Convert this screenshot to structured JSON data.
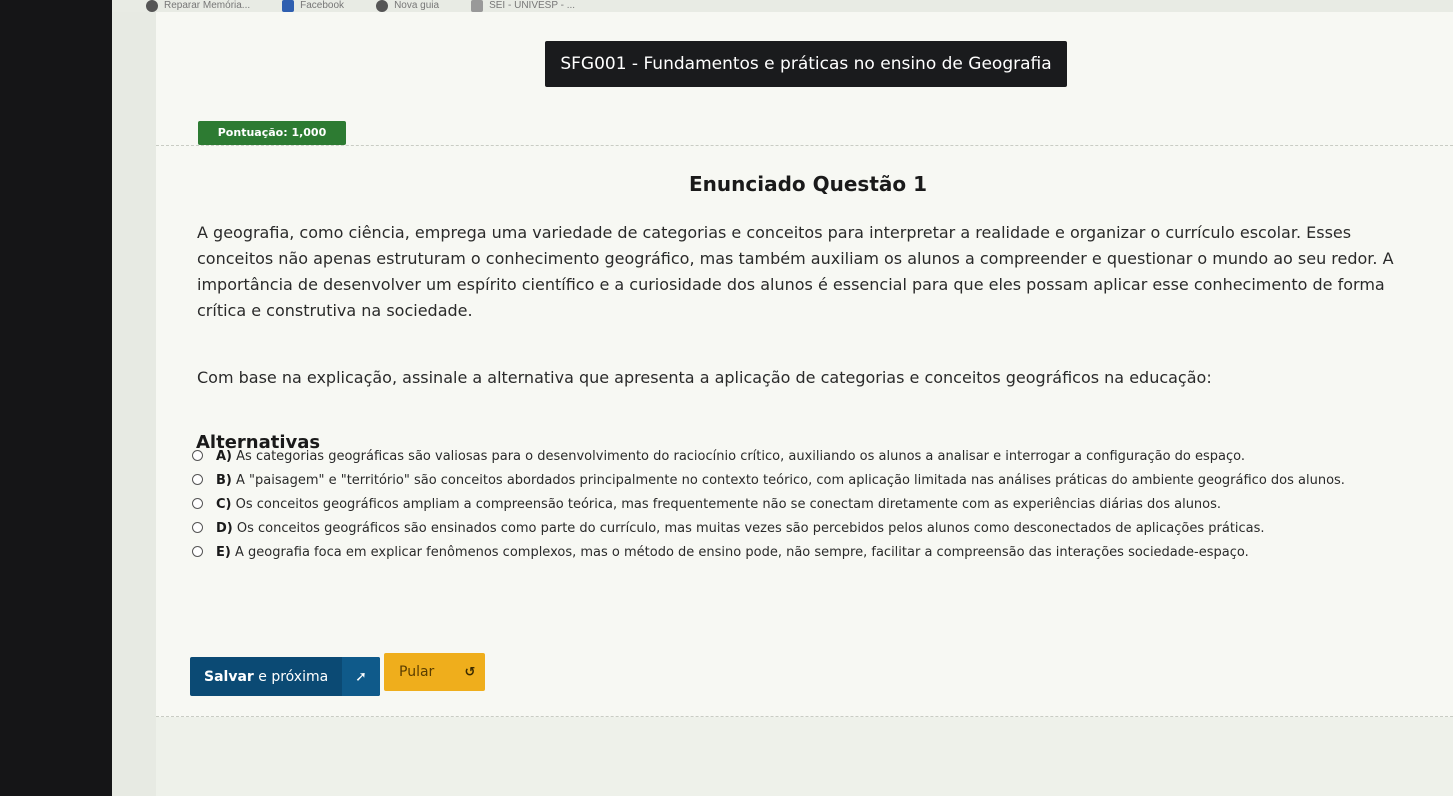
{
  "browser": {
    "bookmarks": [
      {
        "label": "Reparar Memória...",
        "icon": "bookmark-icon"
      },
      {
        "label": "Facebook",
        "icon": "facebook-icon"
      },
      {
        "label": "Nova guia",
        "icon": "globe-icon"
      },
      {
        "label": "SEI - UNIVESP - ...",
        "icon": "bookmark-icon"
      }
    ]
  },
  "course": {
    "title": "SFG001 - Fundamentos e práticas no ensino de Geografia"
  },
  "score": {
    "label": "Pontuação: 1,000"
  },
  "question": {
    "title": "Enunciado Questão 1",
    "statement": "A geografia, como ciência, emprega uma variedade de categorias e conceitos para interpretar a realidade e organizar o currículo escolar. Esses conceitos não apenas estruturam o conhecimento geográfico, mas também auxiliam os alunos a compreender e questionar o mundo ao seu redor. A importância de desenvolver um espírito científico e a curiosidade dos alunos é essencial para que eles possam aplicar esse conhecimento de forma crítica e construtiva na sociedade.",
    "prompt": "Com base na explicação, assinale a alternativa que apresenta a aplicação de categorias e conceitos geográficos na educação:"
  },
  "alternatives": {
    "heading": "Alternativas",
    "items": [
      {
        "letter": "A)",
        "text": "As categorias geográficas são valiosas para o desenvolvimento do raciocínio crítico, auxiliando os alunos a analisar e interrogar a configuração do espaço.",
        "selected": false
      },
      {
        "letter": "B)",
        "text": "A \"paisagem\" e \"território\" são conceitos abordados principalmente no contexto teórico, com aplicação limitada nas análises práticas do ambiente geográfico dos alunos.",
        "selected": false
      },
      {
        "letter": "C)",
        "text": "Os conceitos geográficos ampliam a compreensão teórica, mas frequentemente não se conectam diretamente com as experiências diárias dos alunos.",
        "selected": false
      },
      {
        "letter": "D)",
        "text": "Os conceitos geográficos são ensinados como parte do currículo, mas muitas vezes são percebidos pelos alunos como desconectados de aplicações práticas.",
        "selected": false
      },
      {
        "letter": "E)",
        "text": "A geografia foca em explicar fenômenos complexos, mas o método de ensino pode, não sempre, facilitar a compreensão das interações sociedade-espaço.",
        "selected": false
      }
    ]
  },
  "actions": {
    "save_bold": "Salvar",
    "save_rest": " e próxima",
    "save_icon": "➚",
    "skip_label": "Pular",
    "skip_icon": "↺"
  },
  "colors": {
    "title_bg": "#1a1b1d",
    "score_bg": "#2d7b32",
    "save_bg": "#0b4a74",
    "skip_bg": "#efae1c"
  }
}
